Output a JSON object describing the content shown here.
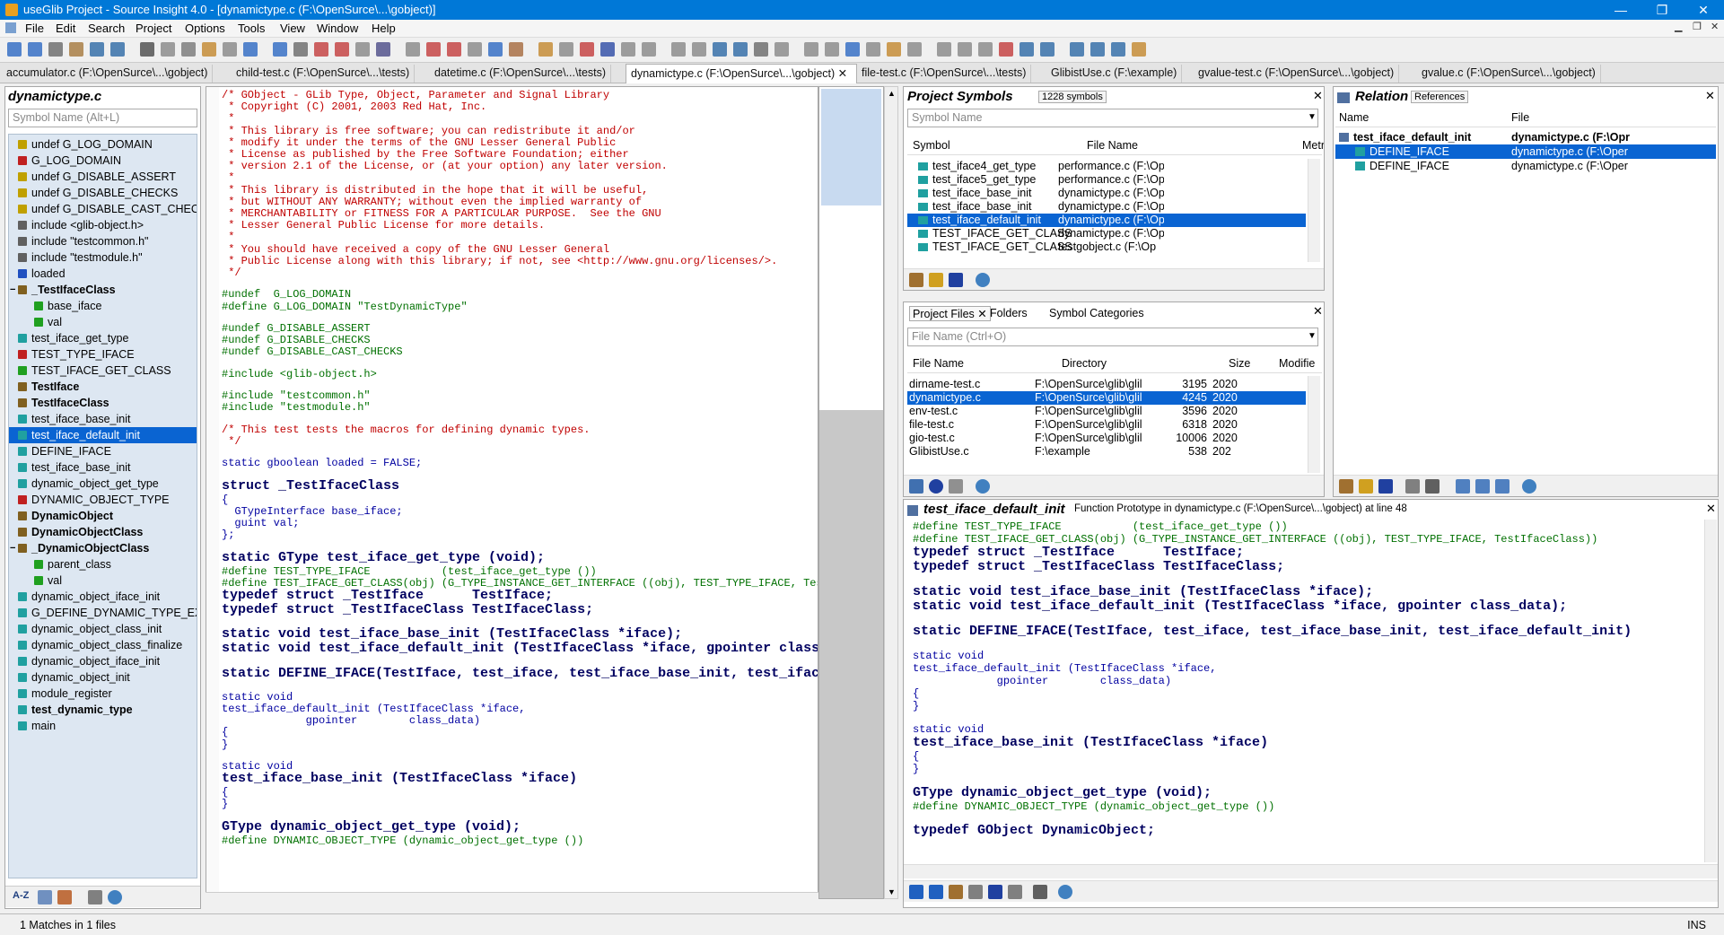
{
  "window": {
    "title": "useGlib Project - Source Insight 4.0 - [dynamictype.c (F:\\OpenSurce\\...\\gobject)]",
    "minimize": "—",
    "restore": "❐",
    "close": "✕"
  },
  "menu": [
    "File",
    "Edit",
    "Search",
    "Project",
    "Options",
    "Tools",
    "View",
    "Window",
    "Help"
  ],
  "tabs": [
    "accumulator.c (F:\\OpenSurce\\...\\gobject)",
    "child-test.c (F:\\OpenSurce\\...\\tests)",
    "datetime.c (F:\\OpenSurce\\...\\tests)",
    "dynamictype.c (F:\\OpenSurce\\...\\gobject)",
    "file-test.c (F:\\OpenSurce\\...\\tests)",
    "GlibistUse.c (F:\\example)",
    "gvalue-test.c (F:\\OpenSurce\\...\\gobject)",
    "gvalue.c (F:\\OpenSurce\\...\\gobject)"
  ],
  "symbol_window": {
    "title": "dynamictype.c",
    "search_placeholder": "Symbol Name (Alt+L)",
    "items": [
      {
        "label": "undef G_LOG_DOMAIN",
        "icon": "#",
        "color": "#c0a000"
      },
      {
        "label": "G_LOG_DOMAIN",
        "icon": "#",
        "color": "#c02020"
      },
      {
        "label": "undef G_DISABLE_ASSERT",
        "icon": "#",
        "color": "#c0a000"
      },
      {
        "label": "undef G_DISABLE_CHECKS",
        "icon": "#",
        "color": "#c0a000"
      },
      {
        "label": "undef G_DISABLE_CAST_CHECK",
        "icon": "#",
        "color": "#c0a000"
      },
      {
        "label": "include <glib-object.h>",
        "icon": "i",
        "color": "#606060"
      },
      {
        "label": "include \"testcommon.h\"",
        "icon": "i",
        "color": "#606060"
      },
      {
        "label": "include \"testmodule.h\"",
        "icon": "i",
        "color": "#606060"
      },
      {
        "label": "loaded",
        "icon": "v",
        "color": "#2050c0"
      },
      {
        "label": "_TestIfaceClass",
        "icon": "s",
        "color": "#806020",
        "bold": true,
        "expander": "−"
      },
      {
        "label": "base_iface",
        "icon": "m",
        "color": "#20a020",
        "indent": 1
      },
      {
        "label": "val",
        "icon": "m",
        "color": "#20a020",
        "indent": 1
      },
      {
        "label": "test_iface_get_type",
        "icon": "f",
        "color": "#20a0a0"
      },
      {
        "label": "TEST_TYPE_IFACE",
        "icon": "#",
        "color": "#c02020"
      },
      {
        "label": "TEST_IFACE_GET_CLASS",
        "icon": "M",
        "color": "#20a020"
      },
      {
        "label": "TestIface",
        "icon": "t",
        "color": "#806020",
        "bold": true
      },
      {
        "label": "TestIfaceClass",
        "icon": "t",
        "color": "#806020",
        "bold": true
      },
      {
        "label": "test_iface_base_init",
        "icon": "f",
        "color": "#20a0a0"
      },
      {
        "label": "test_iface_default_init",
        "icon": "f",
        "color": "#20a0a0",
        "selected": true
      },
      {
        "label": "DEFINE_IFACE",
        "icon": "f",
        "color": "#20a0a0"
      },
      {
        "label": "test_iface_base_init",
        "icon": "f",
        "color": "#20a0a0"
      },
      {
        "label": "dynamic_object_get_type",
        "icon": "f",
        "color": "#20a0a0"
      },
      {
        "label": "DYNAMIC_OBJECT_TYPE",
        "icon": "#",
        "color": "#c02020"
      },
      {
        "label": "DynamicObject",
        "icon": "t",
        "color": "#806020",
        "bold": true
      },
      {
        "label": "DynamicObjectClass",
        "icon": "t",
        "color": "#806020",
        "bold": true
      },
      {
        "label": "_DynamicObjectClass",
        "icon": "s",
        "color": "#806020",
        "bold": true,
        "expander": "−"
      },
      {
        "label": "parent_class",
        "icon": "m",
        "color": "#20a020",
        "indent": 1
      },
      {
        "label": "val",
        "icon": "m",
        "color": "#20a020",
        "indent": 1
      },
      {
        "label": "dynamic_object_iface_init",
        "icon": "f",
        "color": "#20a0a0"
      },
      {
        "label": "G_DEFINE_DYNAMIC_TYPE_EXT",
        "icon": "f",
        "color": "#20a0a0"
      },
      {
        "label": "dynamic_object_class_init",
        "icon": "f",
        "color": "#20a0a0"
      },
      {
        "label": "dynamic_object_class_finalize",
        "icon": "f",
        "color": "#20a0a0"
      },
      {
        "label": "dynamic_object_iface_init",
        "icon": "f",
        "color": "#20a0a0"
      },
      {
        "label": "dynamic_object_init",
        "icon": "f",
        "color": "#20a0a0"
      },
      {
        "label": "module_register",
        "icon": "f",
        "color": "#20a0a0"
      },
      {
        "label": "test_dynamic_type",
        "icon": "f",
        "color": "#20a0a0",
        "bold": true
      },
      {
        "label": "main",
        "icon": "f",
        "color": "#20a0a0"
      }
    ],
    "sort_label": "A-Z"
  },
  "editor": {
    "lines": [
      {
        "t": "/* GObject - GLib Type, Object, Parameter and Signal Library",
        "c": "cm"
      },
      {
        "t": " * Copyright (C) 2001, 2003 Red Hat, Inc.",
        "c": "cm"
      },
      {
        "t": " *",
        "c": "cm"
      },
      {
        "t": " * This library is free software; you can redistribute it and/or",
        "c": "cm"
      },
      {
        "t": " * modify it under the terms of the GNU Lesser General Public",
        "c": "cm"
      },
      {
        "t": " * License as published by the Free Software Foundation; either",
        "c": "cm"
      },
      {
        "t": " * version 2.1 of the License, or (at your option) any later version.",
        "c": "cm"
      },
      {
        "t": " *",
        "c": "cm"
      },
      {
        "t": " * This library is distributed in the hope that it will be useful,",
        "c": "cm"
      },
      {
        "t": " * but WITHOUT ANY WARRANTY; without even the implied warranty of",
        "c": "cm"
      },
      {
        "t": " * MERCHANTABILITY or FITNESS FOR A PARTICULAR PURPOSE.  See the GNU",
        "c": "cm"
      },
      {
        "t": " * Lesser General Public License for more details.",
        "c": "cm"
      },
      {
        "t": " *",
        "c": "cm"
      },
      {
        "t": " * You should have received a copy of the GNU Lesser General",
        "c": "cm"
      },
      {
        "t": " * Public License along with this library; if not, see <http://www.gnu.org/licenses/>.",
        "c": "cm"
      },
      {
        "t": " */",
        "c": "cm"
      },
      {
        "t": "",
        "c": ""
      },
      {
        "t": "#undef  G_LOG_DOMAIN",
        "c": "pp"
      },
      {
        "t": "#define G_LOG_DOMAIN \"TestDynamicType\"",
        "c": "pp"
      },
      {
        "t": "",
        "c": ""
      },
      {
        "t": "#undef G_DISABLE_ASSERT",
        "c": "pp"
      },
      {
        "t": "#undef G_DISABLE_CHECKS",
        "c": "pp"
      },
      {
        "t": "#undef G_DISABLE_CAST_CHECKS",
        "c": "pp"
      },
      {
        "t": "",
        "c": ""
      },
      {
        "t": "#include <glib-object.h>",
        "c": "pp"
      },
      {
        "t": "",
        "c": ""
      },
      {
        "t": "#include \"testcommon.h\"",
        "c": "pp"
      },
      {
        "t": "#include \"testmodule.h\"",
        "c": "pp"
      },
      {
        "t": "",
        "c": ""
      },
      {
        "t": "/* This test tests the macros for defining dynamic types.",
        "c": "cm"
      },
      {
        "t": " */",
        "c": "cm"
      },
      {
        "t": "",
        "c": ""
      },
      {
        "t": "static gboolean loaded = FALSE;",
        "c": "kw"
      },
      {
        "t": "",
        "c": ""
      },
      {
        "t": "struct _TestIfaceClass",
        "c": "big"
      },
      {
        "t": "{",
        "c": "kw"
      },
      {
        "t": "  GTypeInterface base_iface;",
        "c": "kw"
      },
      {
        "t": "  guint val;",
        "c": "kw"
      },
      {
        "t": "};",
        "c": "kw"
      },
      {
        "t": "",
        "c": ""
      },
      {
        "t": "static GType test_iface_get_type (void);",
        "c": "big"
      },
      {
        "t": "#define TEST_TYPE_IFACE           (test_iface_get_type ())",
        "c": "pp"
      },
      {
        "t": "#define TEST_IFACE_GET_CLASS(obj) (G_TYPE_INSTANCE_GET_INTERFACE ((obj), TEST_TYPE_IFACE, TestI",
        "c": "pp"
      },
      {
        "t": "typedef struct _TestIface      TestIface;",
        "c": "big"
      },
      {
        "t": "typedef struct _TestIfaceClass TestIfaceClass;",
        "c": "big"
      },
      {
        "t": "",
        "c": ""
      },
      {
        "t": "static void test_iface_base_init (TestIfaceClass *iface);",
        "c": "big"
      },
      {
        "t": "static void test_iface_default_init (TestIfaceClass *iface, gpointer class_data);",
        "c": "big"
      },
      {
        "t": "",
        "c": ""
      },
      {
        "t": "static DEFINE_IFACE(TestIface, test_iface, test_iface_base_init, test_iface_default_init)",
        "c": "big"
      },
      {
        "t": "",
        "c": ""
      },
      {
        "t": "static void",
        "c": "kw"
      },
      {
        "t": "test_iface_default_init (TestIfaceClass *iface,",
        "c": "kw"
      },
      {
        "t": "             gpointer        class_data)",
        "c": "kw"
      },
      {
        "t": "{",
        "c": "kw"
      },
      {
        "t": "}",
        "c": "kw"
      },
      {
        "t": "",
        "c": ""
      },
      {
        "t": "static void",
        "c": "kw"
      },
      {
        "t": "test_iface_base_init (TestIfaceClass *iface)",
        "c": "big"
      },
      {
        "t": "{",
        "c": "kw"
      },
      {
        "t": "}",
        "c": "kw"
      },
      {
        "t": "",
        "c": ""
      },
      {
        "t": "GType dynamic_object_get_type (void);",
        "c": "big"
      },
      {
        "t": "#define DYNAMIC_OBJECT_TYPE (dynamic_object_get_type ())",
        "c": "pp"
      }
    ]
  },
  "project_symbols": {
    "title": "Project Symbols",
    "count": "1228 symbols",
    "placeholder": "Symbol Name",
    "columns": [
      "Symbol",
      "File Name",
      "Metr"
    ],
    "rows": [
      {
        "symbol": "test_iface4_get_type",
        "file": "performance.c (F:\\Op"
      },
      {
        "symbol": "test_iface5_get_type",
        "file": "performance.c (F:\\Op"
      },
      {
        "symbol": "test_iface_base_init",
        "file": "dynamictype.c (F:\\Op"
      },
      {
        "symbol": "test_iface_base_init",
        "file": "dynamictype.c (F:\\Op"
      },
      {
        "symbol": "test_iface_default_init",
        "file": "dynamictype.c (F:\\Op",
        "selected": true
      },
      {
        "symbol": "TEST_IFACE_GET_CLASS",
        "file": "dynamictype.c (F:\\Op"
      },
      {
        "symbol": "TEST_IFACE_GET_CLASS",
        "file": "testgobject.c (F:\\Op"
      }
    ]
  },
  "project_files": {
    "tabs": [
      "Project Files",
      "Folders",
      "Symbol Categories"
    ],
    "placeholder": "File Name (Ctrl+O)",
    "columns": [
      "File Name",
      "Directory",
      "Size",
      "Modifie"
    ],
    "rows": [
      {
        "name": "dirname-test.c",
        "dir": "F:\\OpenSurce\\glib\\glil",
        "size": "3195",
        "mod": "2020"
      },
      {
        "name": "dynamictype.c",
        "dir": "F:\\OpenSurce\\glib\\glil",
        "size": "4245",
        "mod": "2020",
        "selected": true
      },
      {
        "name": "env-test.c",
        "dir": "F:\\OpenSurce\\glib\\glil",
        "size": "3596",
        "mod": "2020"
      },
      {
        "name": "file-test.c",
        "dir": "F:\\OpenSurce\\glib\\glil",
        "size": "6318",
        "mod": "2020"
      },
      {
        "name": "gio-test.c",
        "dir": "F:\\OpenSurce\\glib\\glil",
        "size": "10006",
        "mod": "2020"
      },
      {
        "name": "GlibistUse.c",
        "dir": "F:\\example",
        "size": "538",
        "mod": "202"
      }
    ]
  },
  "relation": {
    "title": "Relation",
    "badge": "References",
    "columns": [
      "Name",
      "File"
    ],
    "rows": [
      {
        "name": "test_iface_default_init",
        "file": "dynamictype.c (F:\\Opr",
        "root": true
      },
      {
        "name": "DEFINE_IFACE",
        "file": "dynamictype.c (F:\\Oper",
        "selected": true
      },
      {
        "name": "DEFINE_IFACE",
        "file": "dynamictype.c (F:\\Oper"
      }
    ]
  },
  "context": {
    "symbol": "test_iface_default_init",
    "desc": "Function Prototype in dynamictype.c (F:\\OpenSurce\\...\\gobject) at line 48",
    "lines": [
      {
        "t": "#define TEST_TYPE_IFACE           (test_iface_get_type ())",
        "c": "pp"
      },
      {
        "t": "#define TEST_IFACE_GET_CLASS(obj) (G_TYPE_INSTANCE_GET_INTERFACE ((obj), TEST_TYPE_IFACE, TestIfaceClass))",
        "c": "pp"
      },
      {
        "t": "typedef struct _TestIface      TestIface;",
        "c": "big"
      },
      {
        "t": "typedef struct _TestIfaceClass TestIfaceClass;",
        "c": "big"
      },
      {
        "t": "",
        "c": ""
      },
      {
        "t": "static void test_iface_base_init (TestIfaceClass *iface);",
        "c": "big"
      },
      {
        "t": "static void test_iface_default_init (TestIfaceClass *iface, gpointer class_data);",
        "c": "big"
      },
      {
        "t": "",
        "c": ""
      },
      {
        "t": "static DEFINE_IFACE(TestIface, test_iface, test_iface_base_init, test_iface_default_init)",
        "c": "big"
      },
      {
        "t": "",
        "c": ""
      },
      {
        "t": "static void",
        "c": "kw"
      },
      {
        "t": "test_iface_default_init (TestIfaceClass *iface,",
        "c": "kw"
      },
      {
        "t": "             gpointer        class_data)",
        "c": "kw"
      },
      {
        "t": "{",
        "c": "kw"
      },
      {
        "t": "}",
        "c": "kw"
      },
      {
        "t": "",
        "c": ""
      },
      {
        "t": "static void",
        "c": "kw"
      },
      {
        "t": "test_iface_base_init (TestIfaceClass *iface)",
        "c": "big"
      },
      {
        "t": "{",
        "c": "kw"
      },
      {
        "t": "}",
        "c": "kw"
      },
      {
        "t": "",
        "c": ""
      },
      {
        "t": "GType dynamic_object_get_type (void);",
        "c": "big"
      },
      {
        "t": "#define DYNAMIC_OBJECT_TYPE (dynamic_object_get_type ())",
        "c": "pp"
      },
      {
        "t": "",
        "c": ""
      },
      {
        "t": "typedef GObject DynamicObject;",
        "c": "big"
      }
    ]
  },
  "status": {
    "text": "1 Matches in 1 files",
    "mode": "INS"
  },
  "colors": {
    "accent": "#0078d7",
    "selection": "#0a64d2",
    "symbg": "#dde7f2"
  }
}
